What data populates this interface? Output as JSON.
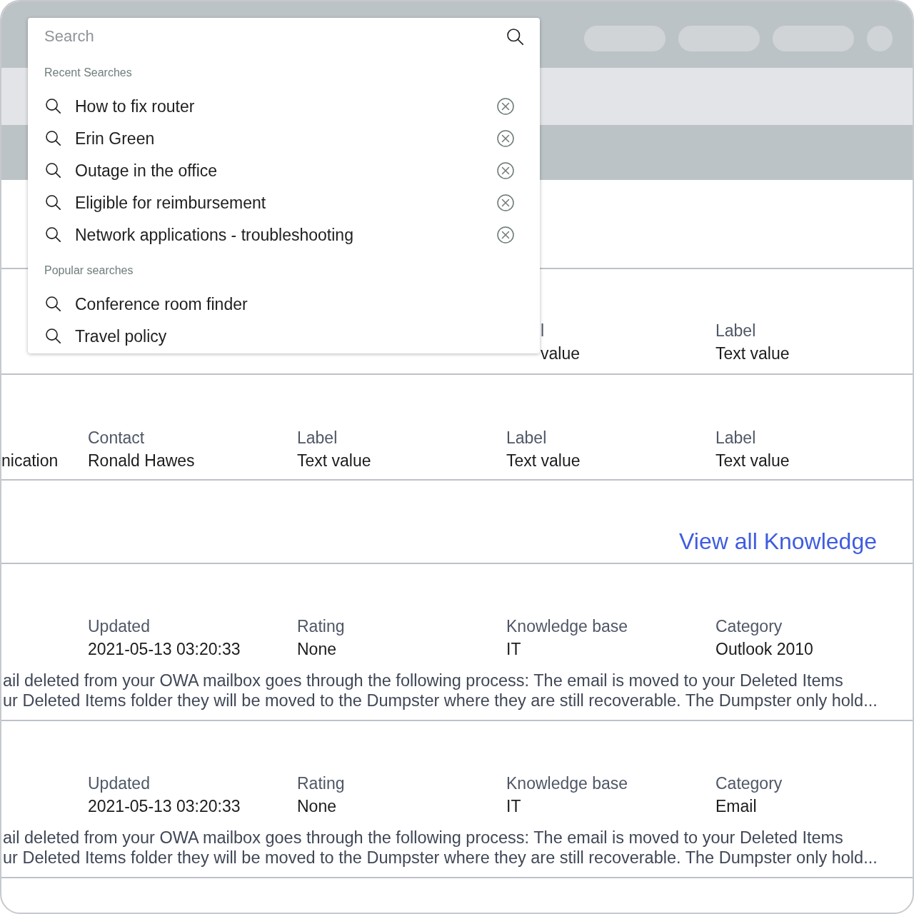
{
  "header": {
    "placeholders": [
      {
        "kind": "pill"
      },
      {
        "kind": "pill"
      },
      {
        "kind": "pill"
      },
      {
        "kind": "circle"
      }
    ]
  },
  "search": {
    "placeholder": "Search",
    "sections": [
      {
        "heading": "Recent Searches",
        "items": [
          {
            "text": "How to fix router",
            "removable": true
          },
          {
            "text": "Erin Green",
            "removable": true
          },
          {
            "text": "Outage in the office",
            "removable": true
          },
          {
            "text": "Eligible for reimbursement",
            "removable": true
          },
          {
            "text": "Network applications - troubleshooting",
            "removable": true
          }
        ]
      },
      {
        "heading": "Popular searches",
        "items": [
          {
            "text": "Conference room finder",
            "removable": false
          },
          {
            "text": "Travel policy",
            "removable": false
          }
        ]
      }
    ]
  },
  "records": [
    {
      "column_4": {
        "label": "l",
        "value": "value"
      },
      "column_5": {
        "label": "Label",
        "value": "Text value"
      }
    },
    {
      "column_1": {
        "value": "nication"
      },
      "column_2": {
        "label": "Contact",
        "value": "Ronald Hawes"
      },
      "column_3": {
        "label": "Label",
        "value": "Text value"
      },
      "column_4": {
        "label": "Label",
        "value": "Text value"
      },
      "column_5": {
        "label": "Label",
        "value": "Text value"
      }
    }
  ],
  "knowledge_link": "View all Knowledge",
  "articles": [
    {
      "fields": [
        {
          "label": "Updated",
          "value": "2021-05-13 03:20:33"
        },
        {
          "label": "Rating",
          "value": "None"
        },
        {
          "label": "Knowledge base",
          "value": "IT"
        },
        {
          "label": "Category",
          "value": "Outlook 2010"
        }
      ],
      "excerpt": "ail deleted from your OWA mailbox goes through the following process: The email is moved to your Deleted Items\nur Deleted Items folder they will be moved to the Dumpster where they are still recoverable. The Dumpster only hold..."
    },
    {
      "fields": [
        {
          "label": "Updated",
          "value": "2021-05-13 03:20:33"
        },
        {
          "label": "Rating",
          "value": "None"
        },
        {
          "label": "Knowledge base",
          "value": "IT"
        },
        {
          "label": "Category",
          "value": "Email"
        }
      ],
      "excerpt": "ail deleted from your OWA mailbox goes through the following process: The email is moved to your Deleted Items\nur Deleted Items folder they will be moved to the Dumpster where they are still recoverable. The Dumpster only hold..."
    }
  ]
}
